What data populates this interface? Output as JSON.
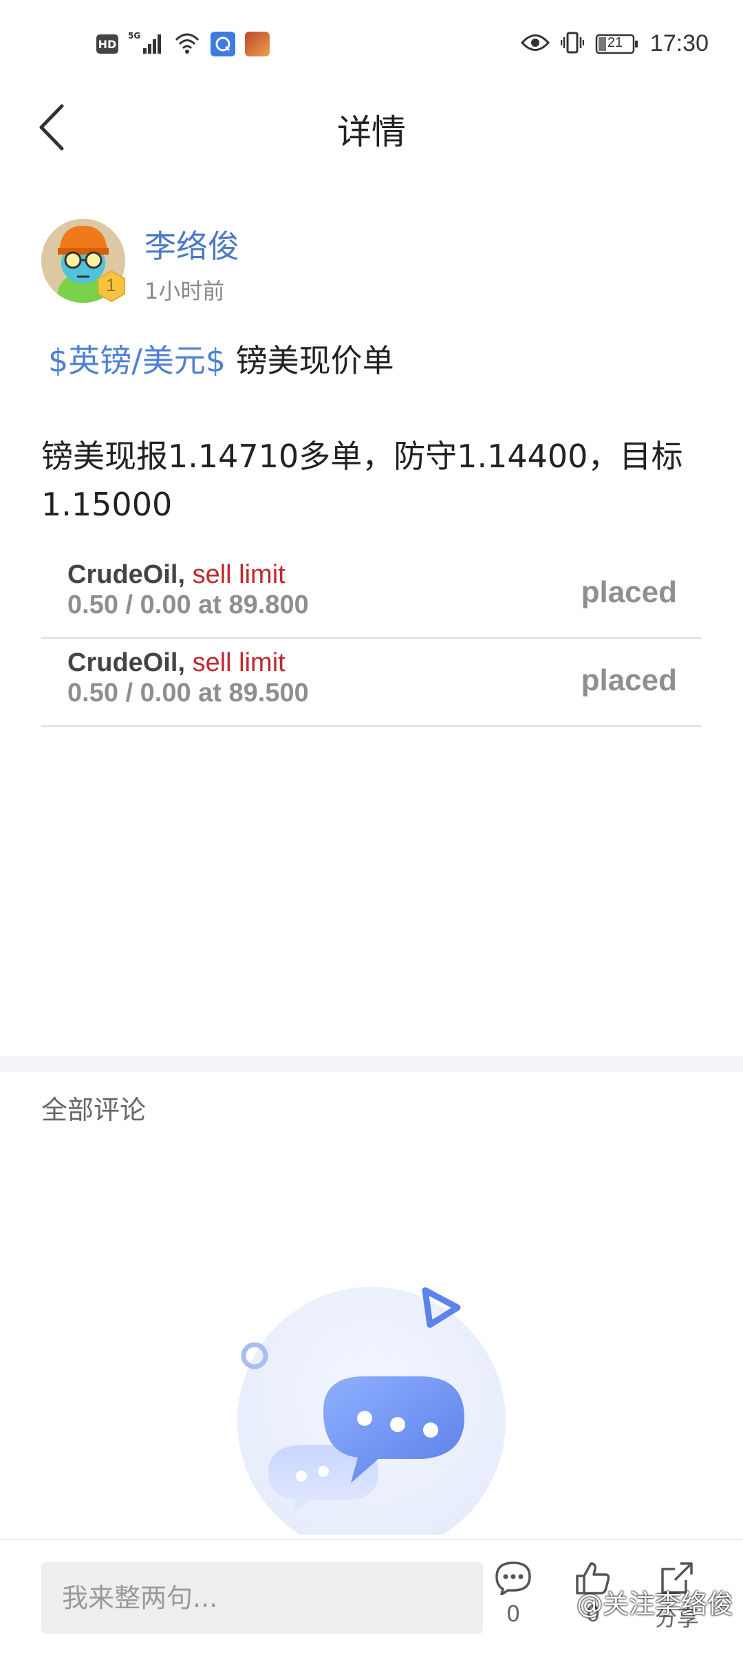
{
  "status_bar": {
    "network_badge": "HD",
    "signal": "5G",
    "battery": "21",
    "time": "17:30"
  },
  "nav": {
    "title": "详情"
  },
  "author": {
    "name": "李络俊",
    "level": "1",
    "time": "1小时前"
  },
  "post": {
    "tag": "$英镑/美元$",
    "title": "镑美现价单",
    "body": "镑美现报1.14710多单，防守1.14400，目标1.15000"
  },
  "orders": [
    {
      "symbol": "CrudeOil,",
      "type": "sell limit",
      "detail": "0.50 / 0.00 at 89.800",
      "status": "placed"
    },
    {
      "symbol": "CrudeOil,",
      "type": "sell limit",
      "detail": "0.50 / 0.00 at 89.500",
      "status": "placed"
    }
  ],
  "comments": {
    "header": "全部评论"
  },
  "bottom_bar": {
    "input_placeholder": "我来整两句...",
    "comment_count": "0",
    "like_count": "0",
    "share_label": "分享"
  },
  "watermark": "@关注李络俊",
  "colors": {
    "link_blue": "#4b78c4",
    "tag_blue": "#4f80d6",
    "sell_red": "#c0272d",
    "muted_gray": "#8f8f8f"
  }
}
